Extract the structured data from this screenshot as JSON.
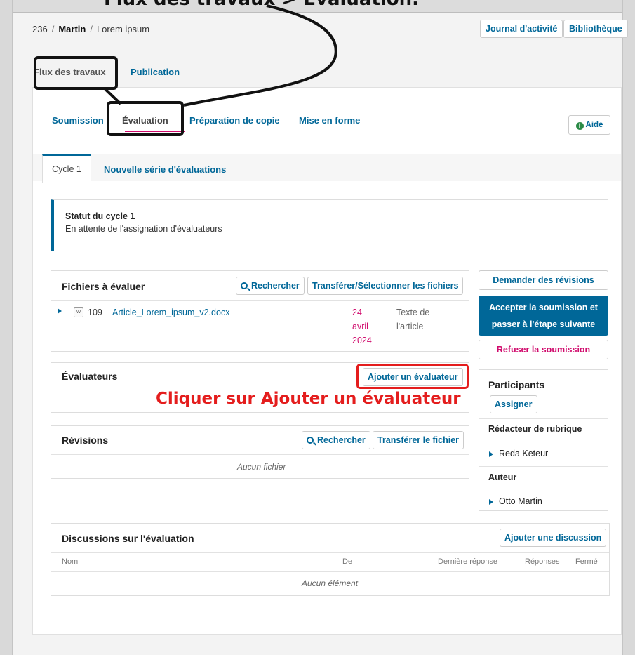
{
  "caption_top": "Flux des travaux > Évaluation.",
  "breadcrumb": {
    "id": "236",
    "sep": "/",
    "author": "Martin",
    "title": "Lorem ipsum"
  },
  "header_buttons": {
    "activity_log": "Journal d'activité",
    "library": "Bibliothèque"
  },
  "top_tabs": {
    "workflow": "Flux des travaux",
    "publication": "Publication"
  },
  "stages": {
    "submission": "Soumission",
    "review": "Évaluation",
    "copyediting": "Préparation de copie",
    "production": "Mise en forme",
    "help": "Aide"
  },
  "cycle_tabs": {
    "cycle1": "Cycle 1",
    "new_round": "Nouvelle série d'évaluations"
  },
  "status": {
    "title": "Statut du cycle 1",
    "text": "En attente de l'assignation d'évaluateurs"
  },
  "review_files": {
    "title": "Fichiers à évaluer",
    "search": "Rechercher",
    "upload_select": "Transférer/Sélectionner les fichiers",
    "file": {
      "icon": "document-icon",
      "id": "109",
      "name": "Article_Lorem_ipsum_v2.docx",
      "date_day": "24",
      "date_month": "avril",
      "date_year": "2024",
      "type_line1": "Texte de",
      "type_line2": "l'article"
    }
  },
  "actions": {
    "request_revisions": "Demander des révisions",
    "accept_line1": "Accepter la soumission et",
    "accept_line2": "passer à l'étape suivante",
    "decline": "Refuser la soumission"
  },
  "reviewers": {
    "title": "Évaluateurs",
    "add_reviewer": "Ajouter un évaluateur"
  },
  "annotation": "Cliquer sur Ajouter un évaluateur",
  "participants": {
    "title": "Participants",
    "assign": "Assigner",
    "groups": [
      {
        "role": "Rédacteur de rubrique",
        "name": "Reda Keteur"
      },
      {
        "role": "Auteur",
        "name": "Otto Martin"
      }
    ]
  },
  "revisions": {
    "title": "Révisions",
    "search": "Rechercher",
    "upload": "Transférer le fichier",
    "empty": "Aucun fichier"
  },
  "discussions": {
    "title": "Discussions sur l'évaluation",
    "add": "Ajouter une discussion",
    "columns": {
      "name": "Nom",
      "from": "De",
      "last_reply": "Dernière réponse",
      "replies": "Réponses",
      "closed": "Fermé"
    },
    "empty": "Aucun élément"
  },
  "colors": {
    "link": "#006798",
    "accent": "#d00a6c",
    "annotation": "#e41d1d"
  }
}
